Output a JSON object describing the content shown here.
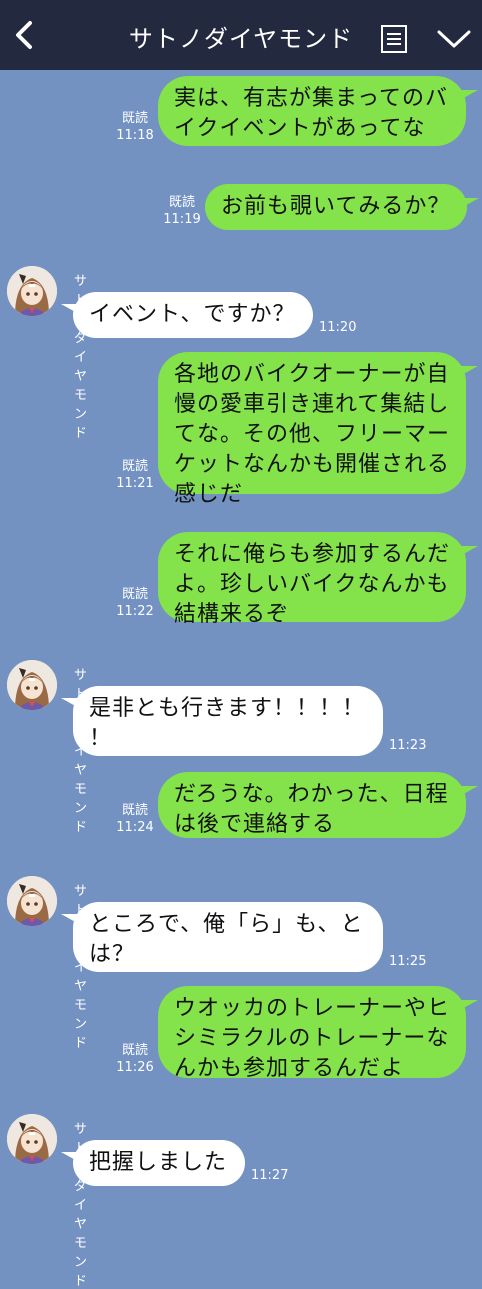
{
  "header": {
    "title": "サトノダイヤモンド"
  },
  "read_label": "既読",
  "sender_name": "サトノダイヤモンド",
  "messages": [
    {
      "dir": "out",
      "text": "実は、有志が集まってのバ\nイクイベントがあってな",
      "time": "11:18"
    },
    {
      "dir": "out",
      "text": "お前も覗いてみるか？",
      "time": "11:19"
    },
    {
      "dir": "in",
      "text": "イベント、ですか？",
      "time": "11:20"
    },
    {
      "dir": "out",
      "text": "各地のバイクオーナーが自\n慢の愛車引き連れて集結し\nてな。その他、フリーマー\nケットなんかも開催される\n感じだ",
      "time": "11:21"
    },
    {
      "dir": "out",
      "text": "それに俺らも参加するんだ\nよ。珍しいバイクなんかも\n結構来るぞ",
      "time": "11:22"
    },
    {
      "dir": "in",
      "text": "是非とも行きます！！！！\n！",
      "time": "11:23"
    },
    {
      "dir": "out",
      "text": "だろうな。わかった、日程\nは後で連絡する",
      "time": "11:24"
    },
    {
      "dir": "in",
      "text": "ところで、俺「ら」も、と\nは？",
      "time": "11:25"
    },
    {
      "dir": "out",
      "text": "ウオッカのトレーナーやヒ\nシミラクルのトレーナーな\nんかも参加するんだよ",
      "time": "11:26"
    },
    {
      "dir": "in",
      "text": "把握しました",
      "time": "11:27"
    }
  ]
}
